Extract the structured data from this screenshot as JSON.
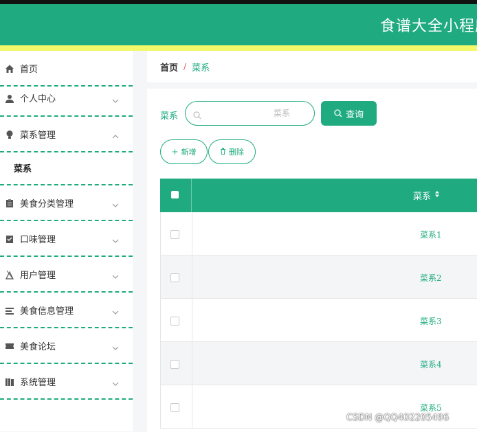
{
  "header": {
    "title": "食谱大全小程序"
  },
  "sidebar": {
    "items": [
      {
        "label": "首页",
        "icon": "home-icon",
        "expandable": false
      },
      {
        "label": "个人中心",
        "icon": "user-icon",
        "expandable": true
      },
      {
        "label": "菜系管理",
        "icon": "bulb-icon",
        "expandable": true,
        "expanded": true
      },
      {
        "label": "美食分类管理",
        "icon": "clipboard-icon",
        "expandable": true
      },
      {
        "label": "口味管理",
        "icon": "checklist-icon",
        "expandable": true
      },
      {
        "label": "用户管理",
        "icon": "user-manage-icon",
        "expandable": true
      },
      {
        "label": "美食信息管理",
        "icon": "list-icon",
        "expandable": true
      },
      {
        "label": "美食论坛",
        "icon": "ticket-icon",
        "expandable": true
      },
      {
        "label": "系统管理",
        "icon": "book-icon",
        "expandable": true
      }
    ],
    "submenu": {
      "label": "菜系"
    }
  },
  "breadcrumb": {
    "home": "首页",
    "separator": "/",
    "current": "菜系"
  },
  "search": {
    "label": "菜系",
    "placeholder": "菜系",
    "button_label": "查询"
  },
  "actions": {
    "add_label": "新增",
    "delete_label": "删除"
  },
  "table": {
    "columns": [
      "菜系"
    ],
    "rows": [
      "菜系1",
      "菜系2",
      "菜系3",
      "菜系4",
      "菜系5"
    ]
  },
  "watermark": "CSDN @QQ402205496",
  "colors": {
    "accent": "#1fab7f",
    "stripe": "#f3f86a"
  }
}
